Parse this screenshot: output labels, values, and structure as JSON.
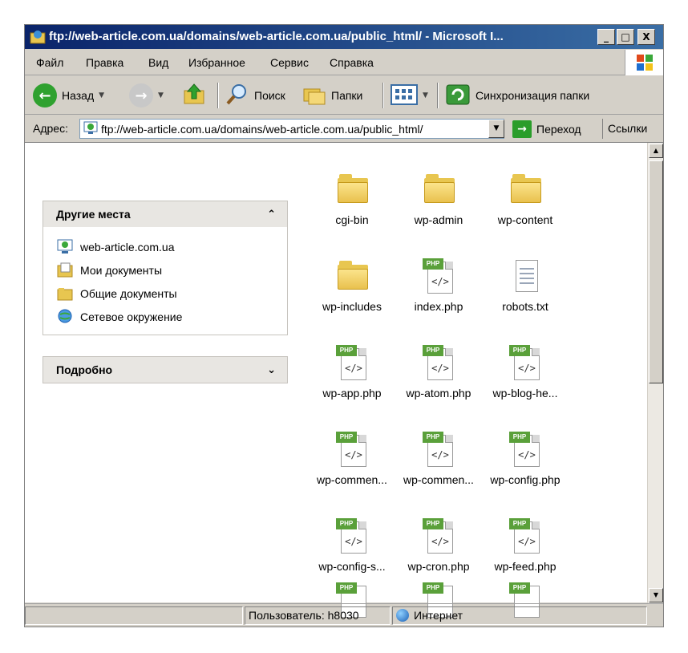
{
  "window": {
    "title": "ftp://web-article.com.ua/domains/web-article.com.ua/public_html/ - Microsoft I...",
    "controls": {
      "minimize": "_",
      "maximize": "□",
      "close": "X"
    }
  },
  "menubar": [
    "Файл",
    "Правка",
    "Вид",
    "Избранное",
    "Сервис",
    "Справка"
  ],
  "toolbar": {
    "back": "Назад",
    "search": "Поиск",
    "folders": "Папки",
    "sync": "Синхронизация папки"
  },
  "address": {
    "label": "Адрес:",
    "url": "ftp://web-article.com.ua/domains/web-article.com.ua/public_html/",
    "go": "Переход",
    "links": "Ссылки"
  },
  "sidebar": {
    "other_places": {
      "title": "Другие места",
      "items": [
        "web-article.com.ua",
        "Мои документы",
        "Общие документы",
        "Сетевое окружение"
      ]
    },
    "details": {
      "title": "Подробно"
    }
  },
  "files": [
    {
      "name": "cgi-bin",
      "type": "folder"
    },
    {
      "name": "wp-admin",
      "type": "folder"
    },
    {
      "name": "wp-content",
      "type": "folder"
    },
    {
      "name": "wp-includes",
      "type": "folder"
    },
    {
      "name": "index.php",
      "type": "php"
    },
    {
      "name": "robots.txt",
      "type": "txt"
    },
    {
      "name": "wp-app.php",
      "type": "php"
    },
    {
      "name": "wp-atom.php",
      "type": "php"
    },
    {
      "name": "wp-blog-he...",
      "type": "php"
    },
    {
      "name": "wp-commen...",
      "type": "php"
    },
    {
      "name": "wp-commen...",
      "type": "php"
    },
    {
      "name": "wp-config.php",
      "type": "php"
    },
    {
      "name": "wp-config-s...",
      "type": "php"
    },
    {
      "name": "wp-cron.php",
      "type": "php"
    },
    {
      "name": "wp-feed.php",
      "type": "php"
    }
  ],
  "icons": {
    "php_tag": "PHP",
    "php_code": "</>"
  },
  "statusbar": {
    "user": "Пользователь: h8030",
    "zone": "Интернет"
  }
}
